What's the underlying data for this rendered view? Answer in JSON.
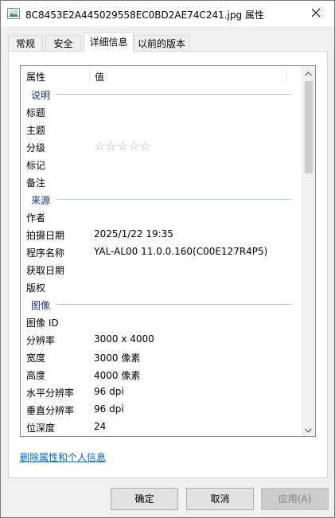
{
  "window": {
    "title": "8C8453E2A445029558EC0BD2AE74C241.jpg 属性"
  },
  "tabs": [
    {
      "label": "常规"
    },
    {
      "label": "安全"
    },
    {
      "label": "详细信息"
    },
    {
      "label": "以前的版本"
    }
  ],
  "columns": {
    "name": "属性",
    "value": "值"
  },
  "groups": {
    "description": "说明",
    "origin": "来源",
    "image": "图像"
  },
  "rows": {
    "title": {
      "name": "标题",
      "value": ""
    },
    "subject": {
      "name": "主题",
      "value": ""
    },
    "rating": {
      "name": "分级",
      "value": "☆☆☆☆☆",
      "stars_filled": 0,
      "stars_total": 5
    },
    "tags": {
      "name": "标记",
      "value": ""
    },
    "comments": {
      "name": "备注",
      "value": ""
    },
    "authors": {
      "name": "作者",
      "value": ""
    },
    "date_taken": {
      "name": "拍摄日期",
      "value": "2025/1/22 19:35"
    },
    "program_name": {
      "name": "程序名称",
      "value": "YAL-AL00 11.0.0.160(C00E127R4P5)"
    },
    "date_acquired": {
      "name": "获取日期",
      "value": ""
    },
    "copyright": {
      "name": "版权",
      "value": ""
    },
    "image_id": {
      "name": "图像 ID",
      "value": ""
    },
    "dimensions": {
      "name": "分辨率",
      "value": "3000 x 4000"
    },
    "width": {
      "name": "宽度",
      "value": "3000 像素"
    },
    "height": {
      "name": "高度",
      "value": "4000 像素"
    },
    "h_resolution": {
      "name": "水平分辨率",
      "value": "96 dpi"
    },
    "v_resolution": {
      "name": "垂直分辨率",
      "value": "96 dpi"
    },
    "bit_depth": {
      "name": "位深度",
      "value": "24"
    }
  },
  "link": {
    "remove_properties": "删除属性和个人信息"
  },
  "buttons": {
    "ok": "确定",
    "cancel": "取消",
    "apply": "应用(A)"
  },
  "colors": {
    "group_header": "#1e3287",
    "link": "#0066cc"
  },
  "icons": {
    "title": "image-file-icon",
    "close": "close-icon",
    "scroll_up": "chevron-up-icon",
    "scroll_down": "chevron-down-icon"
  }
}
